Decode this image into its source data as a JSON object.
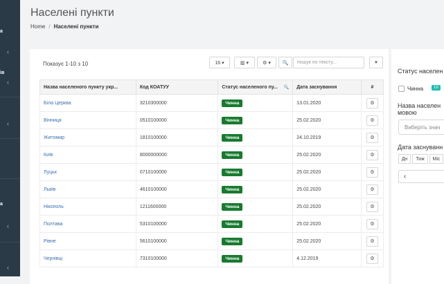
{
  "sidebar": {
    "labels": [
      "а",
      "ів",
      "а"
    ],
    "chevron": "‹"
  },
  "page": {
    "title": "Населені пункти"
  },
  "breadcrumb": {
    "home": "Home",
    "separator": "/",
    "current": "Населені пункти"
  },
  "table_info": {
    "showing": "Показує 1-10 з 10"
  },
  "toolbar": {
    "page_size": "16 ▾",
    "columns_icon": "▥ ▾",
    "settings_icon": "⚙ ▾",
    "search_icon": "🔍",
    "search_placeholder": "пошук по тексту...",
    "filter_icon": "▼"
  },
  "table": {
    "columns": [
      "Назва населеного пункту укр...",
      "Код КОАТУУ",
      "Статус населеного пу...",
      "Дата заснування",
      "#"
    ],
    "status_column_search_icon": "🔍",
    "rows": [
      {
        "name": "Біла Церква",
        "code": "3210300000",
        "status": "Чинна",
        "date": "13.01.2020"
      },
      {
        "name": "Вінниця",
        "code": "0510100000",
        "status": "Чинна",
        "date": "25.02.2020"
      },
      {
        "name": "Житомир",
        "code": "1810100000",
        "status": "Чинна",
        "date": "24.10.2019"
      },
      {
        "name": "Київ",
        "code": "8000000000",
        "status": "Чинна",
        "date": "25.02.2020"
      },
      {
        "name": "Луцьк",
        "code": "0710100000",
        "status": "Чинна",
        "date": "25.02.2020"
      },
      {
        "name": "Львів",
        "code": "4610100000",
        "status": "Чинна",
        "date": "25.02.2020"
      },
      {
        "name": "Нікополь",
        "code": "1211600000",
        "status": "Чинна",
        "date": "25.02.2020"
      },
      {
        "name": "Полтава",
        "code": "5310100000",
        "status": "Чинна",
        "date": "25.02.2020"
      },
      {
        "name": "Рівне",
        "code": "5610100000",
        "status": "Чинна",
        "date": "25.02.2020"
      },
      {
        "name": "Чернівці",
        "code": "7310100000",
        "status": "Чинна",
        "date": "4.12.2019"
      }
    ],
    "action_icon": "⚙"
  },
  "filters": {
    "status_title": "Статус населен",
    "status_option": "Чинна",
    "status_count": "10",
    "name_title_line1": "Назва населен",
    "name_title_line2": "мовою",
    "name_placeholder": "Виберіть знач",
    "date_title": "Дата заснуванн",
    "date_segments": [
      "Дн",
      "Тиж",
      "Міс"
    ],
    "prev_icon": "‹"
  },
  "colors": {
    "sidebar": "#2b3a47",
    "link": "#3a6fb0",
    "status_green": "#187a2f",
    "count_teal": "#1bbdb5"
  }
}
